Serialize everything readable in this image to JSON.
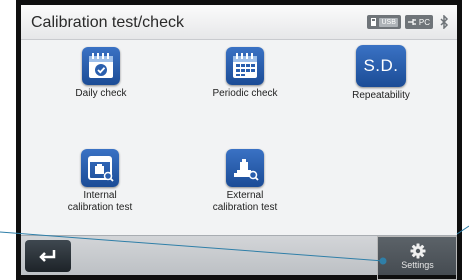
{
  "header": {
    "title": "Calibration test/check",
    "status": {
      "usb_label": "USB",
      "pc_label": "PC"
    }
  },
  "tiles": [
    {
      "label": "Daily check",
      "icon": "calendar-check-icon"
    },
    {
      "label": "Periodic check",
      "icon": "calendar-grid-icon"
    },
    {
      "label": "Repeatability",
      "icon_text": "S.D."
    },
    {
      "label_line1": "Internal",
      "label_line2": "calibration test",
      "icon": "internal-weight-icon"
    },
    {
      "label_line1": "External",
      "label_line2": "calibration test",
      "icon": "external-weight-icon"
    }
  ],
  "footer": {
    "back_icon": "return-arrow-icon",
    "settings_label": "Settings",
    "settings_icon": "gear-icon"
  },
  "colors": {
    "icon_blue": "#2a5fae",
    "header_bg": "#eeeff1",
    "footer_bg": "#c7cacd",
    "bezel": "#0f0f0f"
  }
}
